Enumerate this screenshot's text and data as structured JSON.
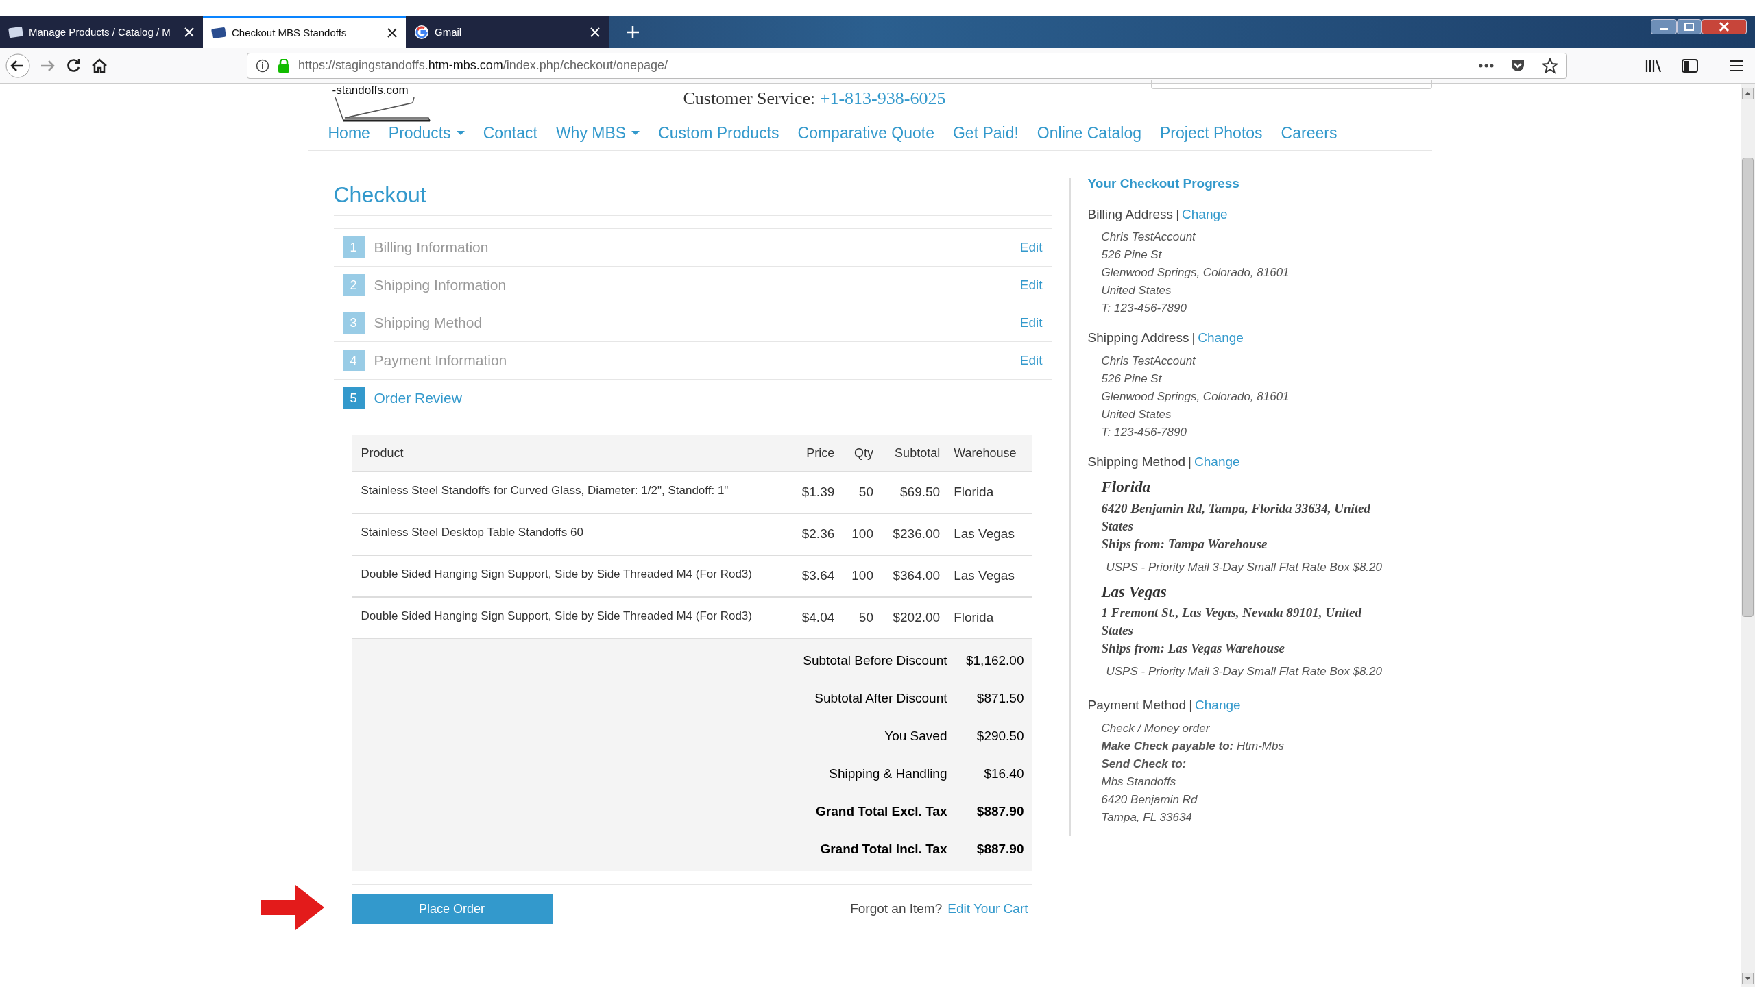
{
  "browser": {
    "tabs": [
      {
        "title": "Manage Products / Catalog / M",
        "selected": false,
        "kind": "store"
      },
      {
        "title": "Checkout MBS Standoffs",
        "selected": true,
        "kind": "store"
      },
      {
        "title": "Gmail",
        "selected": false,
        "kind": "mail"
      }
    ],
    "url_host_prefix": "https://stagingstandoffs.",
    "url_host": "htm-mbs.com",
    "url_path": "/index.php/checkout/onepage/"
  },
  "header": {
    "logo_text": "-standoffs.com",
    "service_label": "Customer Service:",
    "service_phone": "+1-813-938-6025"
  },
  "nav": [
    {
      "label": "Home",
      "dropdown": false
    },
    {
      "label": "Products",
      "dropdown": true
    },
    {
      "label": "Contact",
      "dropdown": false
    },
    {
      "label": "Why MBS",
      "dropdown": true
    },
    {
      "label": "Custom Products",
      "dropdown": false
    },
    {
      "label": "Comparative Quote",
      "dropdown": false
    },
    {
      "label": "Get Paid!",
      "dropdown": false
    },
    {
      "label": "Online Catalog",
      "dropdown": false
    },
    {
      "label": "Project Photos",
      "dropdown": false
    },
    {
      "label": "Careers",
      "dropdown": false
    }
  ],
  "checkout": {
    "title": "Checkout",
    "steps": [
      {
        "number": "1",
        "label": "Billing Information",
        "edit": "Edit",
        "selected": false
      },
      {
        "number": "2",
        "label": "Shipping Information",
        "edit": "Edit",
        "selected": false
      },
      {
        "number": "3",
        "label": "Shipping Method",
        "edit": "Edit",
        "selected": false
      },
      {
        "number": "4",
        "label": "Payment Information",
        "edit": "Edit",
        "selected": false
      },
      {
        "number": "5",
        "label": "Order Review",
        "selected": true
      }
    ]
  },
  "table": {
    "columns": [
      "Product",
      "Price",
      "Qty",
      "Subtotal",
      "Warehouse"
    ],
    "rows": [
      [
        "Stainless Steel Standoffs for Curved Glass, Diameter: 1/2\", Standoff: 1\"",
        "$1.39",
        "50",
        "$69.50",
        "Florida"
      ],
      [
        "Stainless Steel Desktop Table Standoffs 60",
        "$2.36",
        "100",
        "$236.00",
        "Las Vegas"
      ],
      [
        "Double Sided Hanging Sign Support, Side by Side Threaded M4 (For Rod3)",
        "$3.64",
        "100",
        "$364.00",
        "Las Vegas"
      ],
      [
        "Double Sided Hanging Sign Support, Side by Side Threaded M4 (For Rod3)",
        "$4.04",
        "50",
        "$202.00",
        "Florida"
      ]
    ],
    "totals": [
      {
        "label": "Subtotal Before Discount",
        "value": "$1,162.00",
        "bold": false
      },
      {
        "label": "Subtotal After Discount",
        "value": "$871.50",
        "bold": false
      },
      {
        "label": "You Saved",
        "value": "$290.50",
        "bold": false
      },
      {
        "label": "Shipping & Handling",
        "value": "$16.40",
        "bold": false
      },
      {
        "label": "Grand Total Excl. Tax",
        "value": "$887.90",
        "bold": true
      },
      {
        "label": "Grand Total Incl. Tax",
        "value": "$887.90",
        "bold": true
      }
    ]
  },
  "footer": {
    "place_order": "Place Order",
    "forgot": "Forgot an Item?",
    "edit_cart": "Edit Your Cart"
  },
  "progress": {
    "title": "Your Checkout Progress",
    "sections": [
      {
        "kind": "lines",
        "label": "Billing Address",
        "separator": "|",
        "change": "Change",
        "lines": [
          "Chris TestAccount",
          "526 Pine St",
          "Glenwood Springs, Colorado, 81601",
          "United States",
          "T: 123-456-7890"
        ]
      },
      {
        "kind": "lines",
        "label": "Shipping Address",
        "separator": "|",
        "change": "Change",
        "lines": [
          "Chris TestAccount",
          "526 Pine St",
          "Glenwood Springs, Colorado, 81601",
          "United States",
          "T: 123-456-7890"
        ]
      },
      {
        "kind": "shipping",
        "label": "Shipping Method",
        "separator": "|",
        "change": "Change",
        "groups": [
          {
            "name": "Florida",
            "address": "6420 Benjamin Rd, Tampa, Florida 33634, United States",
            "ships_from": "Ships from: Tampa Warehouse",
            "method": "USPS - Priority Mail 3-Day Small Flat Rate Box $8.20"
          },
          {
            "name": "Las Vegas",
            "address": "1 Fremont St., Las Vegas, Nevada 89101, United States",
            "ships_from": "Ships from: Las Vegas Warehouse",
            "method": "USPS - Priority Mail 3-Day Small Flat Rate Box $8.20"
          }
        ]
      },
      {
        "kind": "lines",
        "label": "Payment Method",
        "separator": "|",
        "change": "Change",
        "lines": [
          "Check / Money order",
          "**Make Check payable to:** Htm-Mbs",
          "**Send Check to:**",
          "Mbs Standoffs",
          "6420 Benjamin Rd",
          "Tampa, FL 33634"
        ]
      }
    ]
  }
}
